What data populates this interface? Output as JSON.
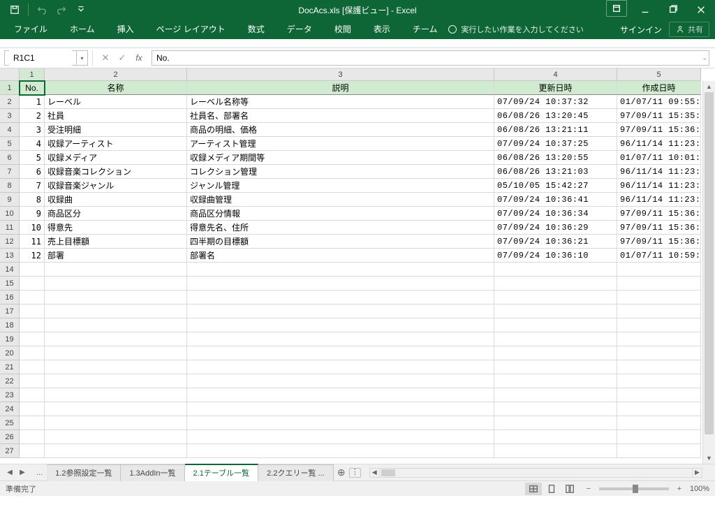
{
  "app": {
    "title": "DocAcs.xls [保護ビュー] - Excel",
    "sign_in": "サインイン",
    "share": "共有"
  },
  "ribbon": {
    "tabs": [
      "ファイル",
      "ホーム",
      "挿入",
      "ページ レイアウト",
      "数式",
      "データ",
      "校閲",
      "表示",
      "チーム"
    ],
    "tellme": "実行したい作業を入力してください"
  },
  "formula_bar": {
    "namebox": "R1C1",
    "formula": "No."
  },
  "columns": {
    "col_headers": [
      "1",
      "2",
      "3",
      "4",
      "5"
    ],
    "widths": [
      "c1",
      "c2",
      "c3",
      "c4",
      "c5"
    ]
  },
  "row_count": 27,
  "table": {
    "headers": [
      "No.",
      "名称",
      "説明",
      "更新日時",
      "作成日時"
    ],
    "rows": [
      {
        "no": "1",
        "name": "レーベル",
        "desc": "レーベル名称等",
        "updated": "07/09/24 10:37:32",
        "created": "01/07/11 09:55:"
      },
      {
        "no": "2",
        "name": "社員",
        "desc": "社員名、部署名",
        "updated": "06/08/26 13:20:45",
        "created": "97/09/11 15:35:"
      },
      {
        "no": "3",
        "name": "受注明細",
        "desc": "商品の明細、価格",
        "updated": "06/08/26 13:21:11",
        "created": "97/09/11 15:36:"
      },
      {
        "no": "4",
        "name": "収録アーティスト",
        "desc": "アーティスト管理",
        "updated": "07/09/24 10:37:25",
        "created": "96/11/14 11:23:"
      },
      {
        "no": "5",
        "name": "収録メディア",
        "desc": "収録メディア期間等",
        "updated": "06/08/26 13:20:55",
        "created": "01/07/11 10:01:"
      },
      {
        "no": "6",
        "name": "収録音楽コレクション",
        "desc": "コレクション管理",
        "updated": "06/08/26 13:21:03",
        "created": "96/11/14 11:23:"
      },
      {
        "no": "7",
        "name": "収録音楽ジャンル",
        "desc": "ジャンル管理",
        "updated": "05/10/05 15:42:27",
        "created": "96/11/14 11:23:"
      },
      {
        "no": "8",
        "name": "収録曲",
        "desc": "収録曲管理",
        "updated": "07/09/24 10:36:41",
        "created": "96/11/14 11:23:"
      },
      {
        "no": "9",
        "name": "商品区分",
        "desc": "商品区分情報",
        "updated": "07/09/24 10:36:34",
        "created": "97/09/11 15:36:"
      },
      {
        "no": "10",
        "name": "得意先",
        "desc": "得意先名、住所",
        "updated": "07/09/24 10:36:29",
        "created": "97/09/11 15:36:"
      },
      {
        "no": "11",
        "name": "売上目標額",
        "desc": "四半期の目標額",
        "updated": "07/09/24 10:36:21",
        "created": "97/09/11 15:36:"
      },
      {
        "no": "12",
        "name": "部署",
        "desc": "部署名",
        "updated": "07/09/24 10:36:10",
        "created": "01/07/11 10:59:"
      }
    ]
  },
  "sheet_tabs": {
    "tabs": [
      "1.2参照設定一覧",
      "1.3AddIn一覧",
      "2.1テーブル一覧",
      "2.2クエリー覧 ..."
    ],
    "active_index": 2
  },
  "status": {
    "ready": "準備完了",
    "zoom": "100%"
  }
}
